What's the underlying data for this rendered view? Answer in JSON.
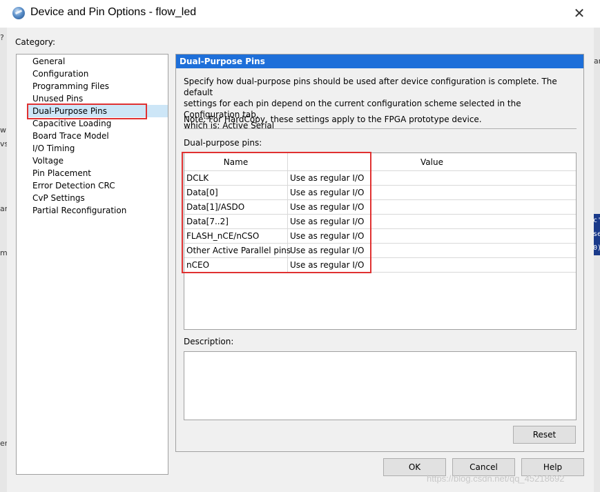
{
  "window": {
    "title": "Device and Pin Options - flow_led",
    "close_label": "✕"
  },
  "category": {
    "label": "Category:",
    "items": [
      "General",
      "Configuration",
      "Programming Files",
      "Unused Pins",
      "Dual-Purpose Pins",
      "Capacitive Loading",
      "Board Trace Model",
      "I/O Timing",
      "Voltage",
      "Pin Placement",
      "Error Detection CRC",
      "CvP Settings",
      "Partial Reconfiguration"
    ],
    "selected": "Dual-Purpose Pins"
  },
  "panel": {
    "header": "Dual-Purpose Pins",
    "description_line1": "Specify how dual-purpose pins should be used after device configuration is complete. The default",
    "description_line2": "settings for each pin depend on the current configuration scheme selected in the Configuration tab,",
    "description_line3": "which is:  Active Serial",
    "note": "Note: For HardCopy, these settings apply to the FPGA prototype device.",
    "pins_label": "Dual-purpose pins:",
    "table": {
      "columns": [
        "Name",
        "Value"
      ],
      "rows": [
        {
          "name": "DCLK",
          "value": "Use as regular I/O"
        },
        {
          "name": "Data[0]",
          "value": "Use as regular I/O"
        },
        {
          "name": "Data[1]/ASDO",
          "value": "Use as regular I/O"
        },
        {
          "name": "Data[7..2]",
          "value": "Use as regular I/O"
        },
        {
          "name": "FLASH_nCE/nCSO",
          "value": "Use as regular I/O"
        },
        {
          "name": "Other Active Parallel pins",
          "value": "Use as regular I/O"
        },
        {
          "name": "nCEO",
          "value": "Use as regular I/O"
        }
      ]
    },
    "desc_label": "Description:",
    "reset_label": "Reset"
  },
  "buttons": {
    "ok": "OK",
    "cancel": "Cancel",
    "help": "Help"
  },
  "background": {
    "frag_1": "ar",
    "frag_2": "w",
    "frag_3": "vs",
    "frag_4": "ar",
    "frag_5": "m",
    "frag_6": "er",
    "frag_7": "?",
    "code_block": [
      "c'",
      "se",
      "0)"
    ]
  },
  "watermark": "https://blog.csdn.net/qq_45218692",
  "colors": {
    "header_blue": "#1e6fd9",
    "highlight_red": "#e03030",
    "selection": "#cde6f7"
  }
}
